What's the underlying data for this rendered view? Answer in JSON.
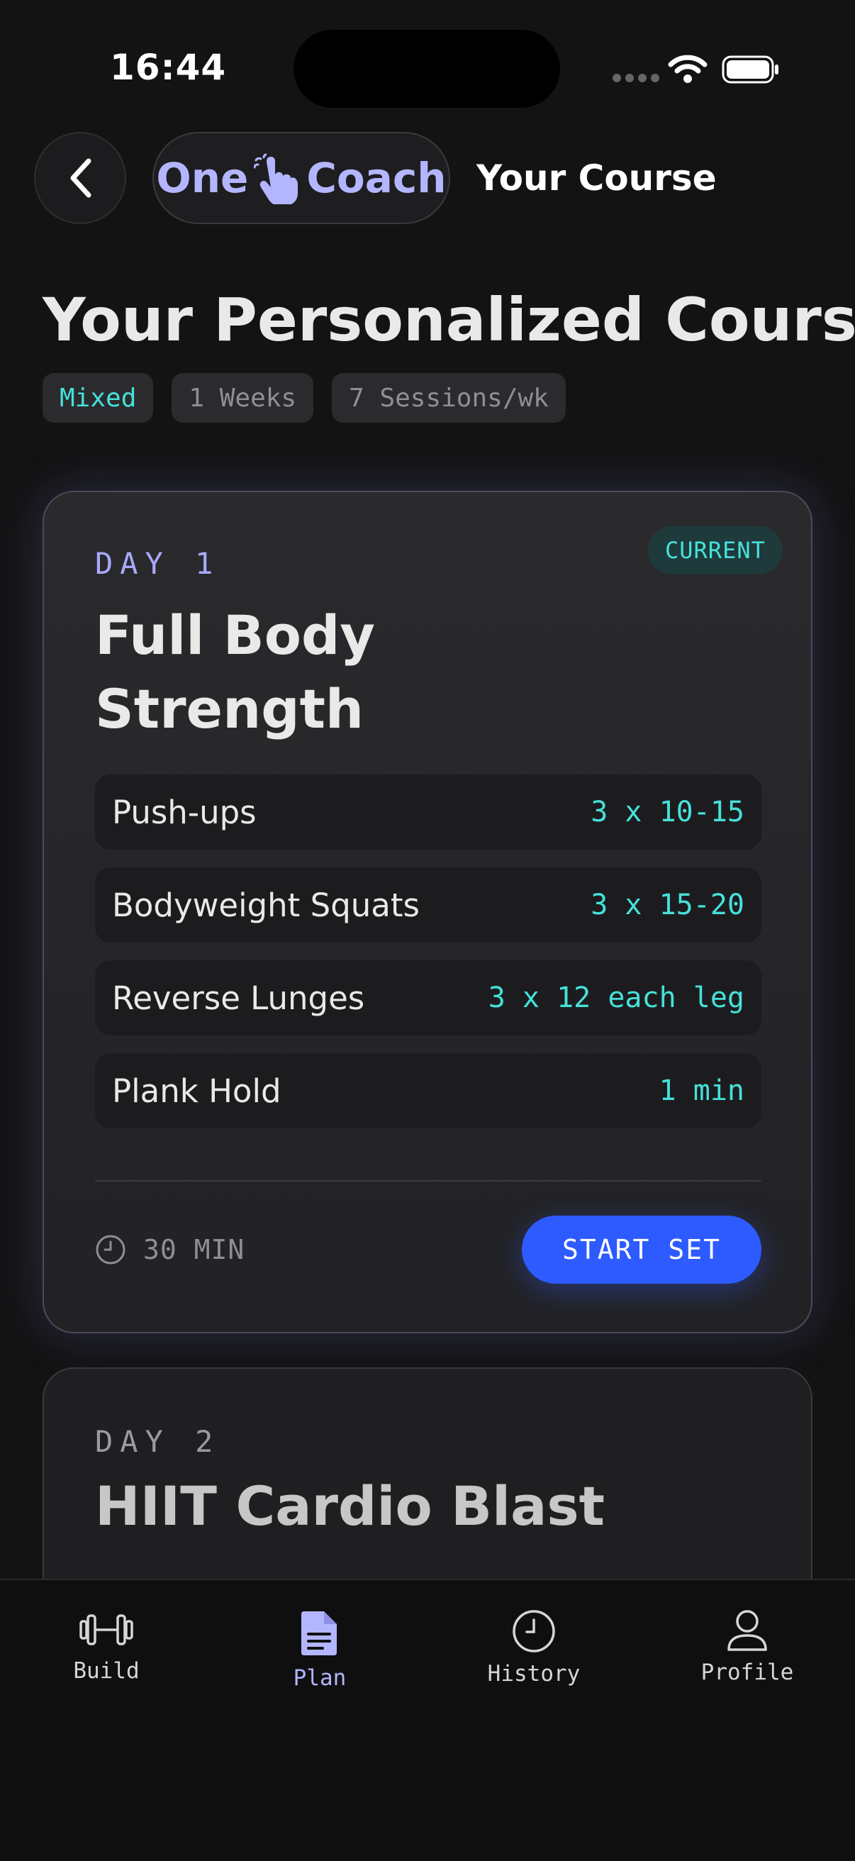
{
  "status": {
    "time": "16:44"
  },
  "header": {
    "brand_left": "One",
    "brand_right": "Coach",
    "title": "Your Course"
  },
  "page": {
    "title": "Your Personalized Course",
    "chips": [
      "Mixed",
      "1 Weeks",
      "7 Sessions/wk"
    ]
  },
  "day1": {
    "badge": "CURRENT",
    "day_label": "DAY 1",
    "title": "Full Body Strength",
    "exercises": [
      {
        "name": "Push-ups",
        "reps": "3 x 10-15"
      },
      {
        "name": "Bodyweight Squats",
        "reps": "3 x 15-20"
      },
      {
        "name": "Reverse Lunges",
        "reps": "3 x 12 each leg"
      },
      {
        "name": "Plank Hold",
        "reps": "1 min"
      }
    ],
    "duration": "30 MIN",
    "start_label": "START SET"
  },
  "day2": {
    "day_label": "DAY 2",
    "title": "HIIT Cardio Blast"
  },
  "tabs": {
    "build": "Build",
    "plan": "Plan",
    "history": "History",
    "profile": "Profile"
  },
  "colors": {
    "accent_cyan": "#46e1da",
    "accent_lavender": "#b3b6ff",
    "primary_blue": "#2d5bff",
    "background": "#131314"
  }
}
